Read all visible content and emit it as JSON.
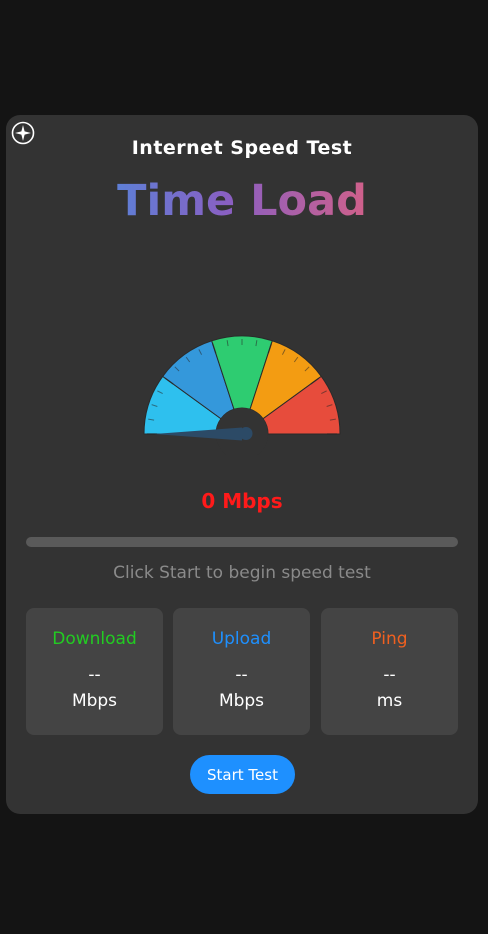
{
  "header": {
    "subtitle": "Internet Speed Test",
    "brand": "Time Load",
    "corner_icon": "compass-icon"
  },
  "gauge": {
    "segments": [
      "#2ec0ee",
      "#3498db",
      "#2ecc71",
      "#f39c12",
      "#e74c3c"
    ],
    "needle_color": "#2c4a66",
    "value_mbps": 0,
    "max_mbps": 100
  },
  "speed": {
    "readout": "0 Mbps",
    "color": "#ff1a1a"
  },
  "progress": {
    "fraction": 0
  },
  "status": {
    "text": "Click Start to begin speed test"
  },
  "stats": {
    "download": {
      "label": "Download",
      "value": "--",
      "unit": "Mbps",
      "color": "#22cc22"
    },
    "upload": {
      "label": "Upload",
      "value": "--",
      "unit": "Mbps",
      "color": "#1e90ff"
    },
    "ping": {
      "label": "Ping",
      "value": "--",
      "unit": "ms",
      "color": "#f06020"
    }
  },
  "actions": {
    "start_label": "Start Test",
    "accent": "#1e90ff"
  }
}
